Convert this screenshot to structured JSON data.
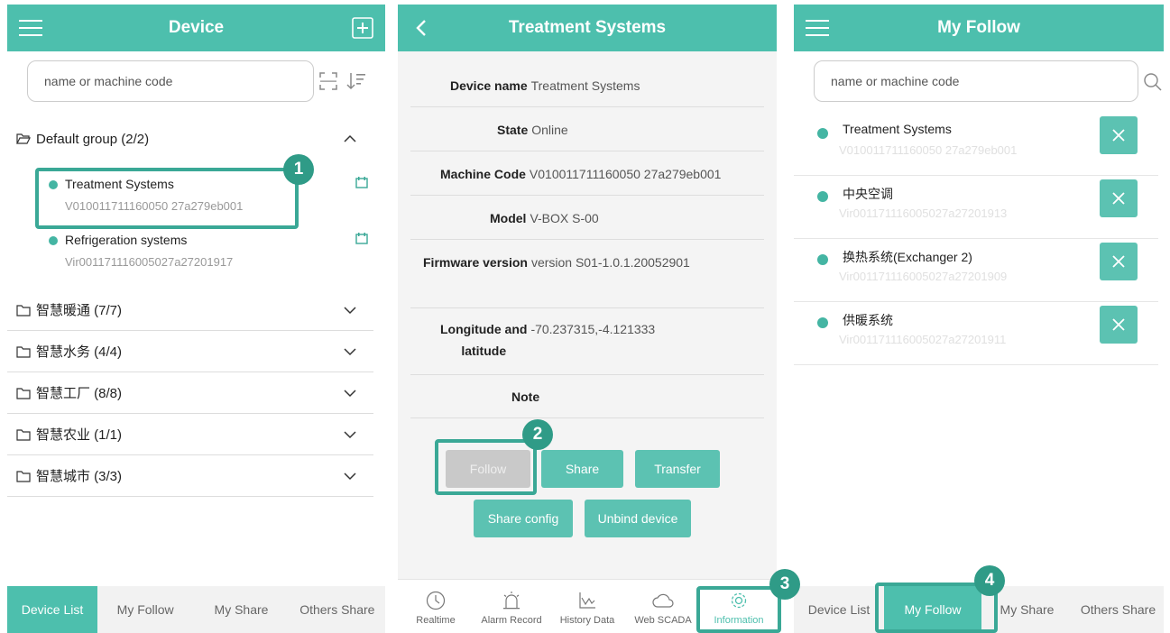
{
  "screen1": {
    "title": "Device",
    "search_placeholder": "name or machine code",
    "groups": [
      {
        "label": "Default group (2/2)"
      },
      {
        "label": "智慧暖通 (7/7)"
      },
      {
        "label": "智慧水务 (4/4)"
      },
      {
        "label": "智慧工厂 (8/8)"
      },
      {
        "label": "智慧农业 (1/1)"
      },
      {
        "label": "智慧城市 (3/3)"
      }
    ],
    "devices": [
      {
        "name": "Treatment Systems",
        "code": "V010011711160050 27a279eb001"
      },
      {
        "name": "Refrigeration systems",
        "code": "Vir001171116005027a27201917"
      }
    ],
    "tabs": [
      "Device List",
      "My Follow",
      "My Share",
      "Others Share"
    ]
  },
  "screen2": {
    "title": "Treatment Systems",
    "rows": [
      {
        "label": "Device name",
        "value": "Treatment Systems"
      },
      {
        "label": "State",
        "value": "Online"
      },
      {
        "label": "Machine Code",
        "value": "V010011711160050 27a279eb001"
      },
      {
        "label": "Model",
        "value": "V-BOX S-00"
      },
      {
        "label": "Firmware version",
        "value": "version  S01-1.0.1.20052901"
      },
      {
        "label": "Longitude and",
        "label2": "latitude",
        "value": "-70.237315,-4.121333"
      },
      {
        "label": "Note",
        "value": ""
      }
    ],
    "buttons": {
      "follow": "Follow",
      "share": "Share",
      "transfer": "Transfer",
      "share_config": "Share config",
      "unbind": "Unbind device"
    },
    "nav": [
      "Realtime",
      "Alarm Record",
      "History Data",
      "Web SCADA",
      "Information"
    ]
  },
  "screen3": {
    "title": "My Follow",
    "search_placeholder": "name or machine code",
    "items": [
      {
        "name": "Treatment Systems",
        "code": "V010011711160050 27a279eb001"
      },
      {
        "name": "中央空调",
        "code": "Vir001171116005027a27201913"
      },
      {
        "name": "换热系统(Exchanger 2)",
        "code": "Vir001171116005027a27201909"
      },
      {
        "name": "供暖系统",
        "code": "Vir001171116005027a27201911"
      }
    ],
    "tabs": [
      "Device List",
      "My Follow",
      "My Share",
      "Others Share"
    ]
  },
  "badges": [
    "1",
    "2",
    "3",
    "4"
  ],
  "colors": {
    "accent": "#4dbfad",
    "highlight": "#3aa896",
    "badge": "#2f9b87"
  }
}
